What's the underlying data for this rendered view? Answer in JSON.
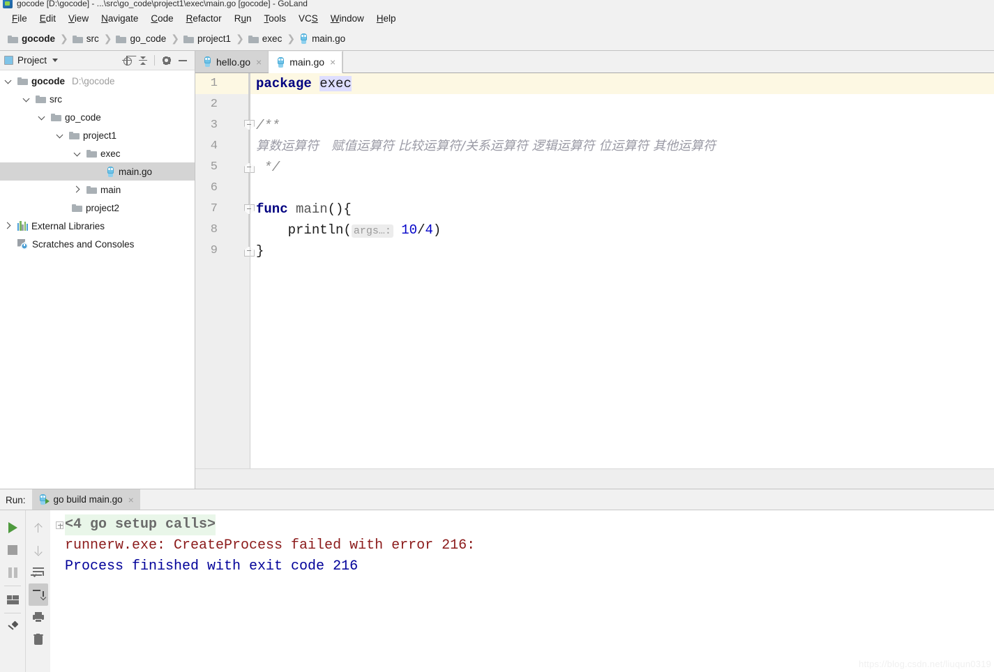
{
  "window": {
    "title": "gocode [D:\\gocode] - ...\\src\\go_code\\project1\\exec\\main.go [gocode] - GoLand",
    "app_icon": "goland-app-icon"
  },
  "menubar": {
    "items": [
      {
        "label": "File",
        "mnemonic": "F"
      },
      {
        "label": "Edit",
        "mnemonic": "E"
      },
      {
        "label": "View",
        "mnemonic": "V"
      },
      {
        "label": "Navigate",
        "mnemonic": "N"
      },
      {
        "label": "Code",
        "mnemonic": "C"
      },
      {
        "label": "Refactor",
        "mnemonic": "R"
      },
      {
        "label": "Run",
        "mnemonic": "u"
      },
      {
        "label": "Tools",
        "mnemonic": "T"
      },
      {
        "label": "VCS",
        "mnemonic": "S"
      },
      {
        "label": "Window",
        "mnemonic": "W"
      },
      {
        "label": "Help",
        "mnemonic": "H"
      }
    ]
  },
  "breadcrumb": {
    "items": [
      {
        "label": "gocode",
        "icon": "folder-icon",
        "bold": true
      },
      {
        "label": "src",
        "icon": "folder-icon",
        "bold": false
      },
      {
        "label": "go_code",
        "icon": "folder-icon",
        "bold": false
      },
      {
        "label": "project1",
        "icon": "folder-icon",
        "bold": false
      },
      {
        "label": "exec",
        "icon": "folder-icon",
        "bold": false
      },
      {
        "label": "main.go",
        "icon": "go-file-icon",
        "bold": false
      }
    ],
    "separator": "❯"
  },
  "project_panel": {
    "title": "Project",
    "title_icon": "project-view-icon",
    "dropdown_caret": "chevron-down-icon",
    "tools": [
      {
        "name": "locate-icon"
      },
      {
        "name": "collapse-all-icon"
      },
      {
        "name": "gear-icon"
      },
      {
        "name": "hide-icon"
      }
    ],
    "tree": [
      {
        "label": "gocode",
        "sub": "D:\\gocode",
        "indent": 0,
        "twisty": "down",
        "icon": "folder-icon",
        "bold": true,
        "selected": false
      },
      {
        "label": "src",
        "sub": "",
        "indent": 1,
        "twisty": "down",
        "icon": "folder-icon",
        "bold": false,
        "selected": false
      },
      {
        "label": "go_code",
        "sub": "",
        "indent": 2,
        "twisty": "down",
        "icon": "folder-icon",
        "bold": false,
        "selected": false
      },
      {
        "label": "project1",
        "sub": "",
        "indent": 3,
        "twisty": "down",
        "icon": "folder-icon",
        "bold": false,
        "selected": false
      },
      {
        "label": "exec",
        "sub": "",
        "indent": 4,
        "twisty": "down",
        "icon": "folder-icon",
        "bold": false,
        "selected": false
      },
      {
        "label": "main.go",
        "sub": "",
        "indent": 6,
        "twisty": "none",
        "icon": "go-file-icon",
        "bold": false,
        "selected": true
      },
      {
        "label": "main",
        "sub": "",
        "indent": 4,
        "twisty": "right",
        "icon": "folder-icon",
        "bold": false,
        "selected": false
      },
      {
        "label": "project2",
        "sub": "",
        "indent": 5,
        "twisty": "none",
        "icon": "folder-icon",
        "bold": false,
        "selected": false
      },
      {
        "label": "External Libraries",
        "sub": "",
        "indent": 0,
        "twisty": "right",
        "icon": "libraries-icon",
        "bold": false,
        "selected": false
      },
      {
        "label": "Scratches and Consoles",
        "sub": "",
        "indent": 1,
        "twisty": "none",
        "icon": "scratches-icon",
        "bold": false,
        "selected": false
      }
    ]
  },
  "editor": {
    "tabs": [
      {
        "label": "hello.go",
        "icon": "go-file-icon",
        "active": false,
        "close": "×"
      },
      {
        "label": "main.go",
        "icon": "go-file-icon",
        "active": true,
        "close": "×"
      }
    ],
    "current_line": 1,
    "line_numbers": [
      1,
      2,
      3,
      4,
      5,
      6,
      7,
      8,
      9
    ],
    "code": {
      "line1_keyword": "package",
      "line1_pkg": "exec",
      "line3": "/**",
      "line4": "算数运算符　赋值运算符 比较运算符/关系运算符 逻辑运算符 位运算符 其他运算符",
      "line5": "*/",
      "line7_keyword": "func",
      "line7_name": "main",
      "line7_tail": "(){",
      "line8_call": "println(",
      "line8_hint": "args…:",
      "line8_num1": "10",
      "line8_slash": "/",
      "line8_num2": "4",
      "line8_paren": ")",
      "line9": "}"
    }
  },
  "run_panel": {
    "label": "Run:",
    "tab": {
      "label": "go build main.go",
      "icon": "go-run-icon",
      "close": "×"
    },
    "toolbar_left": [
      {
        "name": "rerun-play-icon"
      },
      {
        "name": "stop-icon"
      },
      {
        "name": "pause-icon"
      },
      {
        "name": "layout-icon"
      },
      {
        "name": "pin-tab-icon"
      }
    ],
    "toolbar_right": [
      {
        "name": "up-arrow-icon",
        "selected": false
      },
      {
        "name": "down-arrow-icon",
        "selected": false
      },
      {
        "name": "soft-wrap-icon",
        "selected": false
      },
      {
        "name": "scroll-to-end-icon",
        "selected": true
      },
      {
        "name": "print-icon",
        "selected": false
      },
      {
        "name": "trash-icon",
        "selected": false
      }
    ],
    "console": {
      "fold_toggle": "expand-fold-icon",
      "setup_line": "<4 go setup calls>",
      "error_line": "runnerw.exe: CreateProcess failed with error 216:",
      "exit_line": "Process finished with exit code 216"
    }
  },
  "watermark": "https://blog.csdn.net/liuqun0319",
  "colors": {
    "chrome": "#f1f1f1",
    "selection": "#d4d4d4",
    "keyword": "#000080",
    "number": "#0000c8",
    "comment": "#8a8a8a",
    "current_line": "#fdf8e3",
    "setup_bg": "#e9f6e9",
    "error_text": "#8b1a1a",
    "exit_text": "#000099",
    "gopher_blue": "#6fc3e8",
    "run_green": "#4e9a3e"
  }
}
